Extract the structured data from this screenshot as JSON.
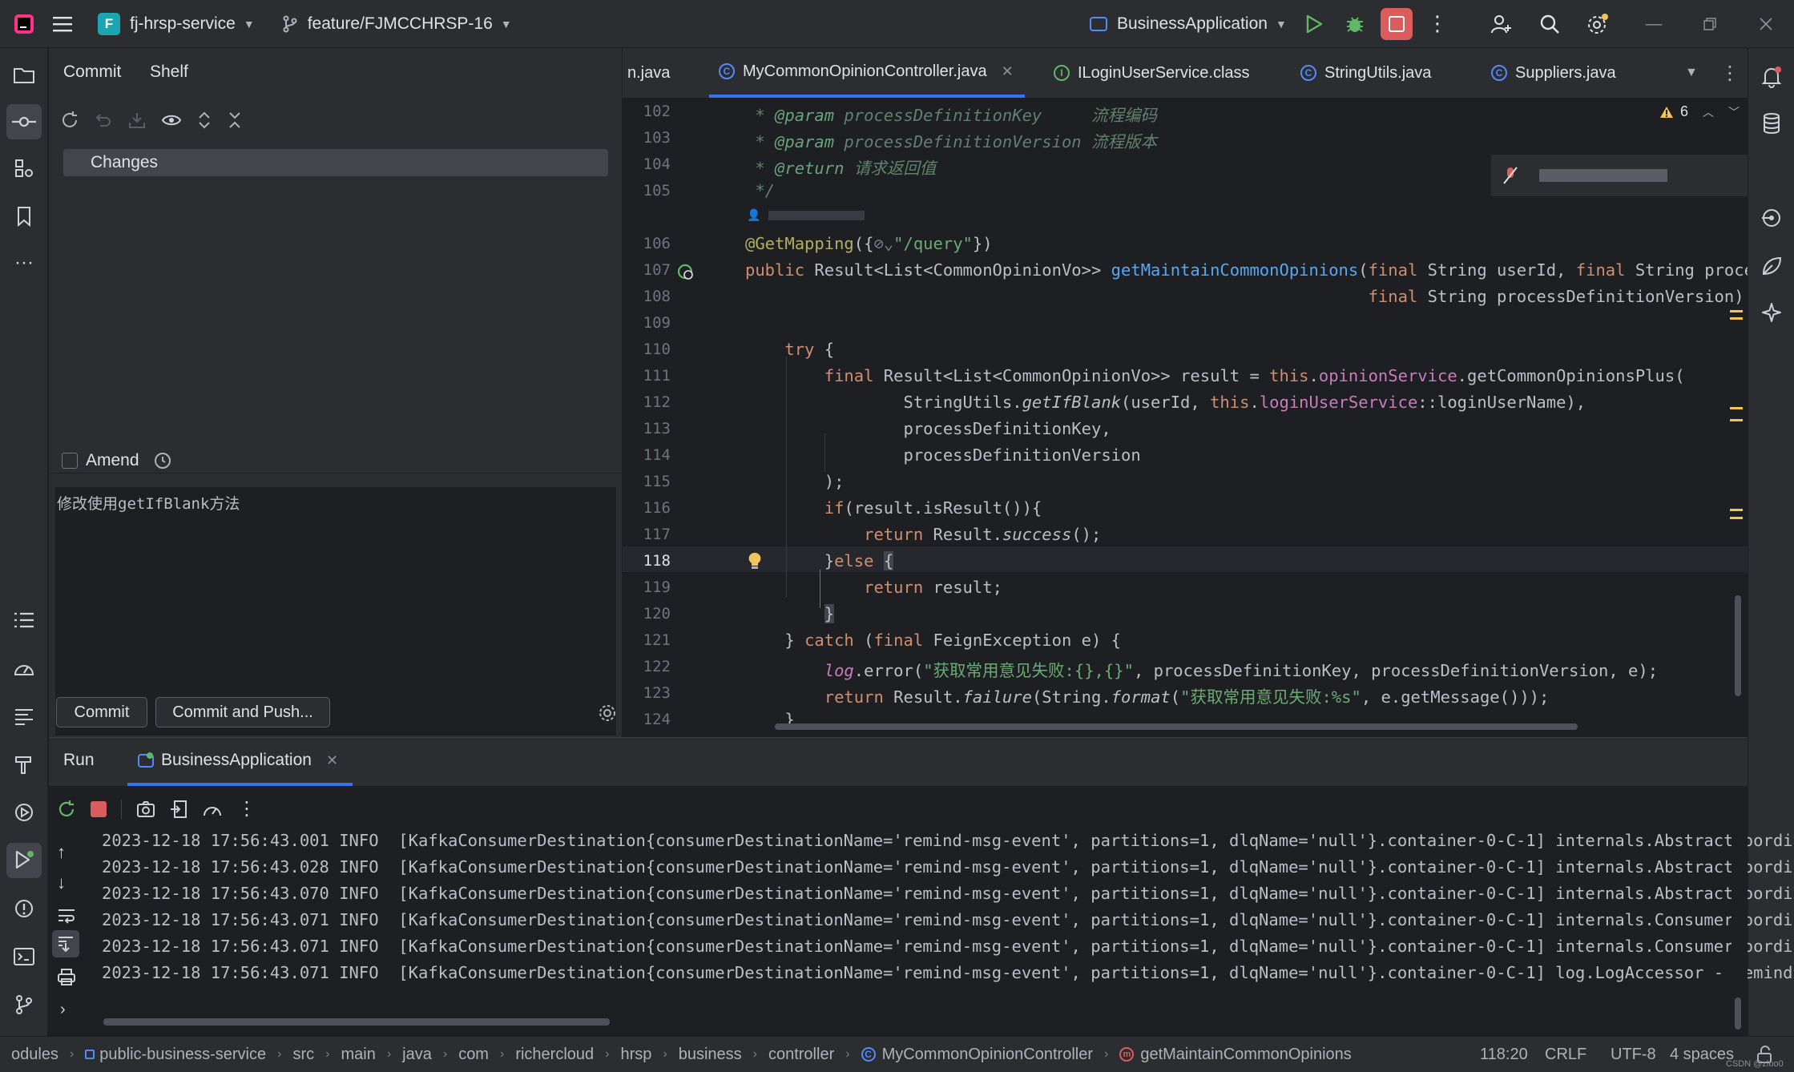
{
  "titlebar": {
    "project_initial": "F",
    "project": "fj-hrsp-service",
    "branch": "feature/FJMCCHRSP-16",
    "run_config": "BusinessApplication"
  },
  "commit_panel": {
    "tabs": [
      "Commit",
      "Shelf"
    ],
    "changes_label": "Changes",
    "amend_label": "Amend",
    "message": "修改使用getIfBlank方法",
    "commit_button": "Commit",
    "commit_push_button": "Commit and Push..."
  },
  "editor_tabs": [
    {
      "label": "n.java",
      "icon": ""
    },
    {
      "label": "MyCommonOpinionController.java",
      "icon": "class-icon",
      "active": true
    },
    {
      "label": "ILoginUserService.class",
      "icon": "interface-icon"
    },
    {
      "label": "StringUtils.java",
      "icon": "class-icon"
    },
    {
      "label": "Suppliers.java",
      "icon": "class-icon"
    }
  ],
  "editor": {
    "warnings_count": "6",
    "author_hint": "(blurred)",
    "line_numbers": [
      "102",
      "103",
      "104",
      "105",
      "106",
      "107",
      "108",
      "109",
      "110",
      "111",
      "112",
      "113",
      "114",
      "115",
      "116",
      "117",
      "118",
      "119",
      "120",
      "121",
      "122",
      "123",
      "124"
    ],
    "current_line": "118"
  },
  "run_panel": {
    "tab_run": "Run",
    "tab_app": "BusinessApplication",
    "log": [
      {
        "ts": "2023-12-18 17:56:43.001",
        "level": "INFO",
        "msg": "[KafkaConsumerDestination{consumerDestinationName='remind-msg-event', partitions=1, dlqName='null'}.container-0-C-1] internals.AbstractCoordi"
      },
      {
        "ts": "2023-12-18 17:56:43.028",
        "level": "INFO",
        "msg": "[KafkaConsumerDestination{consumerDestinationName='remind-msg-event', partitions=1, dlqName='null'}.container-0-C-1] internals.AbstractCoordi"
      },
      {
        "ts": "2023-12-18 17:56:43.070",
        "level": "INFO",
        "msg": "[KafkaConsumerDestination{consumerDestinationName='remind-msg-event', partitions=1, dlqName='null'}.container-0-C-1] internals.AbstractCoordi"
      },
      {
        "ts": "2023-12-18 17:56:43.071",
        "level": "INFO",
        "msg": "[KafkaConsumerDestination{consumerDestinationName='remind-msg-event', partitions=1, dlqName='null'}.container-0-C-1] internals.ConsumerCoordi"
      },
      {
        "ts": "2023-12-18 17:56:43.071",
        "level": "INFO",
        "msg": "[KafkaConsumerDestination{consumerDestinationName='remind-msg-event', partitions=1, dlqName='null'}.container-0-C-1] internals.ConsumerCoordi"
      },
      {
        "ts": "2023-12-18 17:56:43.071",
        "level": "INFO",
        "msg": "[KafkaConsumerDestination{consumerDestinationName='remind-msg-event', partitions=1, dlqName='null'}.container-0-C-1] log.LogAccessor - remind"
      }
    ]
  },
  "statusbar": {
    "breadcrumbs": [
      "odules",
      "public-business-service",
      "src",
      "main",
      "java",
      "com",
      "richercloud",
      "hrsp",
      "business",
      "controller",
      "MyCommonOpinionController",
      "getMaintainCommonOpinions"
    ],
    "position": "118:20",
    "line_sep": "CRLF",
    "encoding": "UTF-8",
    "indent": "4 spaces",
    "watermark": "CSDN @zluo0"
  }
}
